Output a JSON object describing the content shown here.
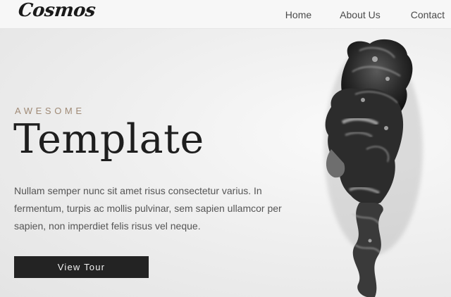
{
  "header": {
    "logo": "Cosmos",
    "nav": [
      "Home",
      "About Us",
      "Contact"
    ]
  },
  "hero": {
    "eyebrow": "AWESOME",
    "title": "Template",
    "description": "Nullam semper nunc sit amet risus consectetur varius. In fermentum, turpis ac mollis pulvinar, sem sapien ullamcor per sapien, non imperdiet felis risus vel neque.",
    "cta_label": "View Tour",
    "image": "smoke-portrait-illustration"
  }
}
